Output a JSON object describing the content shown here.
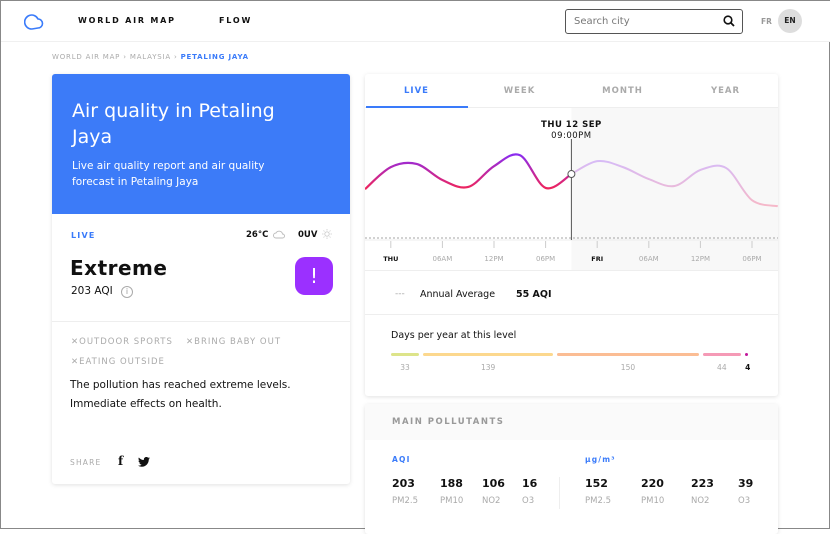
{
  "nav": {
    "logo": "cloud-logo-icon",
    "links": [
      "WORLD AIR MAP",
      "FLOW"
    ],
    "search_placeholder": "Search city",
    "lang": [
      "FR",
      "EN"
    ],
    "active_lang": "EN"
  },
  "breadcrumb": [
    "WORLD AIR MAP",
    "MALAYSIA",
    "PETALING JAYA"
  ],
  "hero": {
    "title": "Air quality in Petaling Jaya",
    "subtitle": "Live air quality report and air quality forecast in Petaling Jaya",
    "color": "#3c7bf8"
  },
  "status": {
    "live": "LIVE",
    "temp": "26°C",
    "uv": "0UV",
    "level": "Extreme",
    "aqi": "203 AQI",
    "badge_color": "#9b30ff"
  },
  "advice": {
    "tags": [
      "OUTDOOR SPORTS",
      "BRING BABY OUT",
      "EATING OUTSIDE"
    ],
    "text": "The pollution has reached extreme levels. Immediate effects on health."
  },
  "share": {
    "label": "SHARE"
  },
  "tabs": [
    "LIVE",
    "WEEK",
    "MONTH",
    "YEAR"
  ],
  "active_tab": "LIVE",
  "chart_data": {
    "type": "line",
    "cursor_label": [
      "THU 12 SEP",
      "09:00PM"
    ],
    "x_ticks": [
      "THU",
      "06AM",
      "12PM",
      "06PM",
      "FRI",
      "06AM",
      "12PM",
      "06PM"
    ],
    "x_hours": [
      -3,
      0,
      3,
      6,
      9,
      12,
      15,
      18,
      21,
      24,
      27,
      30,
      33,
      36,
      39,
      42,
      45
    ],
    "values": [
      155,
      225,
      235,
      184,
      162,
      228,
      263,
      159,
      203,
      244,
      225,
      187,
      165,
      216,
      222,
      120,
      101
    ],
    "current_hour": 21
  },
  "annual": {
    "label": "Annual Average",
    "value": "55 AQI"
  },
  "days": {
    "title": "Days per year at this level",
    "segments": [
      {
        "value": "33",
        "color": "#dde48a"
      },
      {
        "value": "139",
        "color": "#fcd88e"
      },
      {
        "value": "150",
        "color": "#fbbd94"
      },
      {
        "value": "44",
        "color": "#f59ab6"
      },
      {
        "value": "4",
        "color": "#c2189b"
      }
    ]
  },
  "pollutants": {
    "title": "MAIN POLLUTANTS",
    "aqi_label": "AQI",
    "unit_label": "µg/m³",
    "aqi": [
      {
        "v": "203",
        "n": "PM2.5"
      },
      {
        "v": "188",
        "n": "PM10"
      },
      {
        "v": "106",
        "n": "NO2"
      },
      {
        "v": "16",
        "n": "O3"
      }
    ],
    "conc": [
      {
        "v": "152",
        "n": "PM2.5"
      },
      {
        "v": "220",
        "n": "PM10"
      },
      {
        "v": "223",
        "n": "NO2"
      },
      {
        "v": "39",
        "n": "O3"
      }
    ]
  }
}
